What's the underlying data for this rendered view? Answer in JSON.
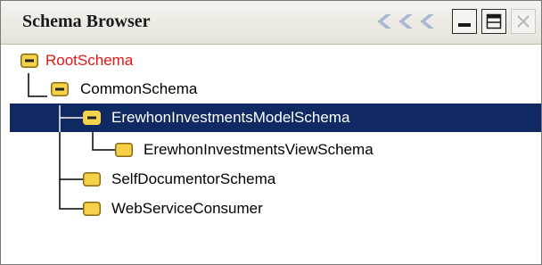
{
  "panel": {
    "title": "Schema Browser"
  },
  "icons": {
    "collapse_chevrons": "triple-chevron-left-icon",
    "minimize": "minimize-icon",
    "maximize": "maximize-icon",
    "close": "close-icon",
    "expanded_node": "minus-folder-icon",
    "leaf_node": "folder-icon"
  },
  "colors": {
    "root_text": "#e41515",
    "selection_bg": "#0f2a63",
    "folder_fill": "#f6d24a",
    "chevron": "#a9b8d6"
  },
  "tree": {
    "nodes": [
      {
        "label": "RootSchema",
        "state": "expanded",
        "depth": 0
      },
      {
        "label": "CommonSchema",
        "state": "expanded",
        "depth": 1
      },
      {
        "label": "ErewhonInvestmentsModelSchema",
        "state": "expanded",
        "depth": 2,
        "selected": true
      },
      {
        "label": "ErewhonInvestmentsViewSchema",
        "state": "leaf",
        "depth": 3
      },
      {
        "label": "SelfDocumentorSchema",
        "state": "leaf",
        "depth": 2
      },
      {
        "label": "WebServiceConsumer",
        "state": "leaf",
        "depth": 2
      }
    ]
  }
}
